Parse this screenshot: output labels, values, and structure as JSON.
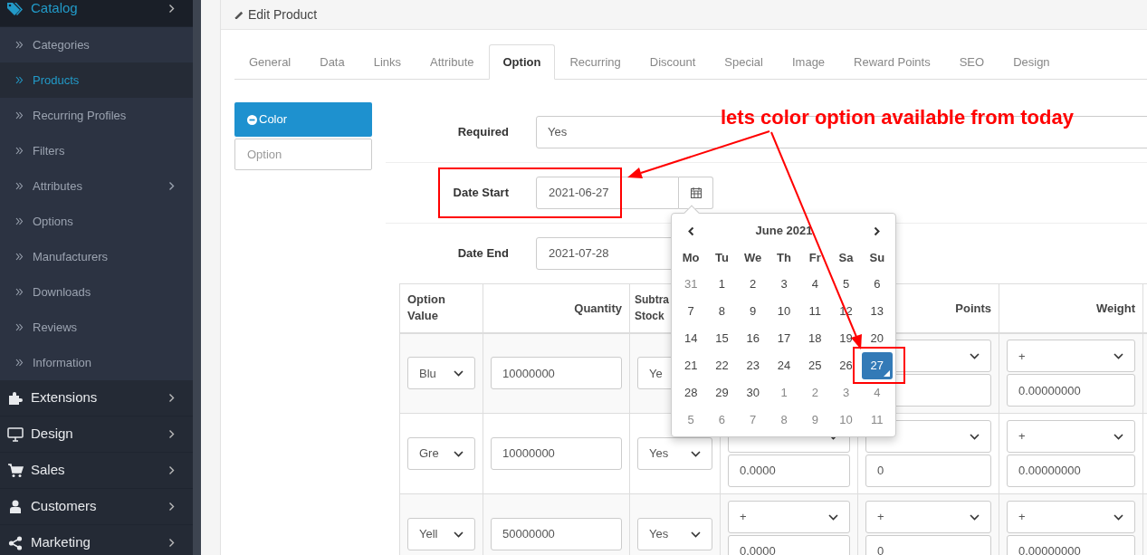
{
  "sidebar": {
    "items": [
      {
        "label": "Catalog",
        "selected": true,
        "children": [
          {
            "label": "Categories",
            "selected": false,
            "expandable": false
          },
          {
            "label": "Products",
            "selected": true,
            "expandable": false
          },
          {
            "label": "Recurring Profiles",
            "selected": false,
            "expandable": false
          },
          {
            "label": "Filters",
            "selected": false,
            "expandable": false
          },
          {
            "label": "Attributes",
            "selected": false,
            "expandable": true
          },
          {
            "label": "Options",
            "selected": false,
            "expandable": false
          },
          {
            "label": "Manufacturers",
            "selected": false,
            "expandable": false
          },
          {
            "label": "Downloads",
            "selected": false,
            "expandable": false
          },
          {
            "label": "Reviews",
            "selected": false,
            "expandable": false
          },
          {
            "label": "Information",
            "selected": false,
            "expandable": false
          }
        ]
      },
      {
        "label": "Extensions",
        "selected": false
      },
      {
        "label": "Design",
        "selected": false
      },
      {
        "label": "Sales",
        "selected": false
      },
      {
        "label": "Customers",
        "selected": false
      },
      {
        "label": "Marketing",
        "selected": false
      }
    ]
  },
  "page_header": {
    "title": "Edit Product"
  },
  "tabs": [
    {
      "label": "General",
      "selected": false
    },
    {
      "label": "Data",
      "selected": false
    },
    {
      "label": "Links",
      "selected": false
    },
    {
      "label": "Attribute",
      "selected": false
    },
    {
      "label": "Option",
      "selected": true
    },
    {
      "label": "Recurring",
      "selected": false
    },
    {
      "label": "Discount",
      "selected": false
    },
    {
      "label": "Special",
      "selected": false
    },
    {
      "label": "Image",
      "selected": false
    },
    {
      "label": "Reward Points",
      "selected": false
    },
    {
      "label": "SEO",
      "selected": false
    },
    {
      "label": "Design",
      "selected": false
    }
  ],
  "option_tabs": [
    {
      "label": "Color",
      "selected": true
    }
  ],
  "option_search": {
    "placeholder": "Option"
  },
  "form": {
    "required": {
      "label": "Required",
      "value": "Yes"
    },
    "date_start": {
      "label": "Date Start",
      "value": "2021-06-27"
    },
    "date_end": {
      "label": "Date End",
      "value": "2021-07-28"
    }
  },
  "datepicker": {
    "month": "June 2021",
    "weekdays": [
      "Mo",
      "Tu",
      "We",
      "Th",
      "Fr",
      "Sa",
      "Su"
    ],
    "weeks": [
      [
        {
          "label": "31",
          "muted": true,
          "selected": false,
          "today": false
        },
        {
          "label": "1",
          "muted": false,
          "selected": false,
          "today": false
        },
        {
          "label": "2",
          "muted": false,
          "selected": false,
          "today": false
        },
        {
          "label": "3",
          "muted": false,
          "selected": false,
          "today": false
        },
        {
          "label": "4",
          "muted": false,
          "selected": false,
          "today": false
        },
        {
          "label": "5",
          "muted": false,
          "selected": false,
          "today": false
        },
        {
          "label": "6",
          "muted": false,
          "selected": false,
          "today": false
        }
      ],
      [
        {
          "label": "7",
          "muted": false,
          "selected": false,
          "today": false
        },
        {
          "label": "8",
          "muted": false,
          "selected": false,
          "today": false
        },
        {
          "label": "9",
          "muted": false,
          "selected": false,
          "today": false
        },
        {
          "label": "10",
          "muted": false,
          "selected": false,
          "today": false
        },
        {
          "label": "11",
          "muted": false,
          "selected": false,
          "today": false
        },
        {
          "label": "12",
          "muted": false,
          "selected": false,
          "today": false
        },
        {
          "label": "13",
          "muted": false,
          "selected": false,
          "today": false
        }
      ],
      [
        {
          "label": "14",
          "muted": false,
          "selected": false,
          "today": false
        },
        {
          "label": "15",
          "muted": false,
          "selected": false,
          "today": false
        },
        {
          "label": "16",
          "muted": false,
          "selected": false,
          "today": false
        },
        {
          "label": "17",
          "muted": false,
          "selected": false,
          "today": false
        },
        {
          "label": "18",
          "muted": false,
          "selected": false,
          "today": false
        },
        {
          "label": "19",
          "muted": false,
          "selected": false,
          "today": false
        },
        {
          "label": "20",
          "muted": false,
          "selected": false,
          "today": false
        }
      ],
      [
        {
          "label": "21",
          "muted": false,
          "selected": false,
          "today": false
        },
        {
          "label": "22",
          "muted": false,
          "selected": false,
          "today": false
        },
        {
          "label": "23",
          "muted": false,
          "selected": false,
          "today": false
        },
        {
          "label": "24",
          "muted": false,
          "selected": false,
          "today": false
        },
        {
          "label": "25",
          "muted": false,
          "selected": false,
          "today": false
        },
        {
          "label": "26",
          "muted": false,
          "selected": false,
          "today": false
        },
        {
          "label": "27",
          "muted": false,
          "selected": true,
          "today": true
        }
      ],
      [
        {
          "label": "28",
          "muted": false,
          "selected": false,
          "today": false
        },
        {
          "label": "29",
          "muted": false,
          "selected": false,
          "today": false
        },
        {
          "label": "30",
          "muted": false,
          "selected": false,
          "today": false
        },
        {
          "label": "1",
          "muted": true,
          "selected": false,
          "today": false
        },
        {
          "label": "2",
          "muted": true,
          "selected": false,
          "today": false
        },
        {
          "label": "3",
          "muted": true,
          "selected": false,
          "today": false
        },
        {
          "label": "4",
          "muted": true,
          "selected": false,
          "today": false
        }
      ],
      [
        {
          "label": "5",
          "muted": true,
          "selected": false,
          "today": false
        },
        {
          "label": "6",
          "muted": true,
          "selected": false,
          "today": false
        },
        {
          "label": "7",
          "muted": true,
          "selected": false,
          "today": false
        },
        {
          "label": "8",
          "muted": true,
          "selected": false,
          "today": false
        },
        {
          "label": "9",
          "muted": true,
          "selected": false,
          "today": false
        },
        {
          "label": "10",
          "muted": true,
          "selected": false,
          "today": false
        },
        {
          "label": "11",
          "muted": true,
          "selected": false,
          "today": false
        }
      ]
    ]
  },
  "table": {
    "columns": {
      "option_value": "Option Value",
      "quantity": "Quantity",
      "subtract_stock": "Subtra Stock",
      "points": "Points",
      "weight": "Weight"
    },
    "rows": [
      {
        "option_value": "Blu",
        "quantity": "10000000",
        "subtract": "Ye",
        "price": {},
        "points": {},
        "weight": {
          "prefix": "+",
          "value": "0.00000000"
        }
      },
      {
        "option_value": "Gre",
        "quantity": "10000000",
        "subtract": "Yes",
        "price": {
          "value": "0.0000"
        },
        "points": {
          "value": "0"
        },
        "weight": {
          "prefix": "+",
          "value": "0.00000000"
        }
      },
      {
        "option_value": "Yell",
        "quantity": "50000000",
        "subtract": "Yes",
        "price": {
          "prefix": "+",
          "value": "0.0000"
        },
        "points": {
          "prefix": "+",
          "value": "0"
        },
        "weight": {
          "prefix": "+",
          "value": "0.00000000"
        }
      }
    ]
  },
  "annotation": {
    "note": "lets color option available from today"
  }
}
